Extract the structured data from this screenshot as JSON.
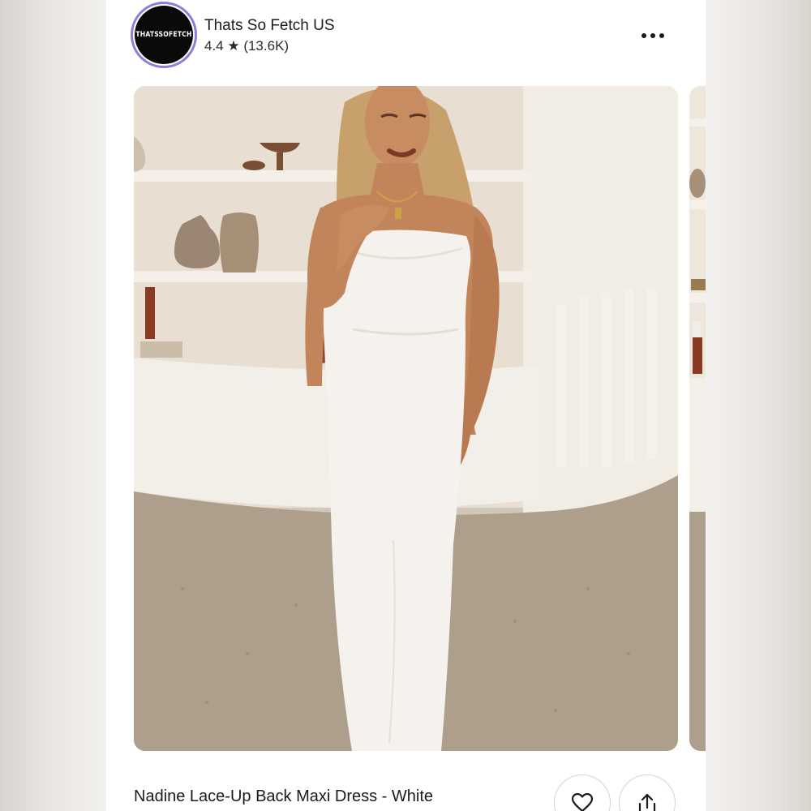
{
  "seller": {
    "logo_text": "THATSSOFETCH",
    "name": "Thats So Fetch US",
    "rating": "4.4 ★ (13.6K)"
  },
  "header": {
    "more_icon": "more-horizontal-icon"
  },
  "listing": {
    "title": "Nadine Lace-Up Back Maxi Dress - White",
    "photo_description": "woman wearing long white cowl-neck slip dress",
    "actions": [
      {
        "name": "like",
        "icon": "heart-icon"
      },
      {
        "name": "share",
        "icon": "share-icon"
      }
    ]
  },
  "colors": {
    "avatar_ring": "#8b7ed8",
    "avatar_fill": "#0a0a0a",
    "dress": "#f4f1ec",
    "wall": "#ece5da",
    "floor": "#ab9c88"
  }
}
